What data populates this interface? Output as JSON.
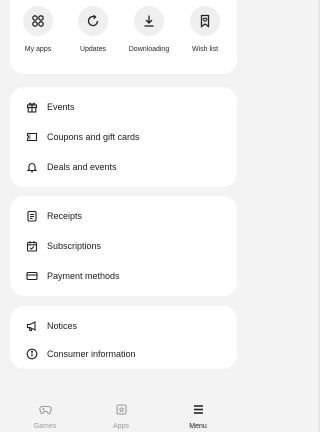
{
  "quick_actions": [
    {
      "label": "My apps",
      "icon": "grid-icon"
    },
    {
      "label": "Updates",
      "icon": "refresh-icon"
    },
    {
      "label": "Downloading",
      "icon": "download-icon"
    },
    {
      "label": "Wish list",
      "icon": "bookmark-heart-icon"
    }
  ],
  "menu": {
    "section1": [
      {
        "label": "Events",
        "icon": "gift-icon"
      },
      {
        "label": "Coupons and gift cards",
        "icon": "ticket-icon"
      },
      {
        "label": "Deals and events",
        "icon": "bell-icon"
      }
    ],
    "section2": [
      {
        "label": "Receipts",
        "icon": "receipt-icon"
      },
      {
        "label": "Subscriptions",
        "icon": "calendar-icon"
      },
      {
        "label": "Payment methods",
        "icon": "card-icon"
      }
    ],
    "section3": [
      {
        "label": "Notices",
        "icon": "megaphone-icon"
      },
      {
        "label": "Consumer information",
        "icon": "info-icon"
      }
    ]
  },
  "bottom_nav": [
    {
      "label": "Games",
      "icon": "gamepad-icon",
      "active": false
    },
    {
      "label": "Apps",
      "icon": "store-icon",
      "active": false
    },
    {
      "label": "Menu",
      "icon": "menu-icon",
      "active": true
    }
  ],
  "colors": {
    "background": "#f3f3f3",
    "card": "#ffffff",
    "inactive_text": "#9a9a9a"
  }
}
